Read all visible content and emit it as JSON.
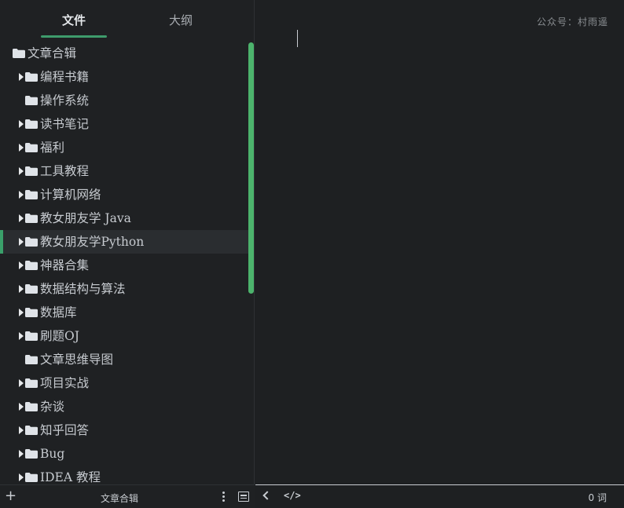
{
  "sidebar": {
    "tabs": [
      {
        "label": "文件",
        "active": true
      },
      {
        "label": "大纲",
        "active": false
      }
    ],
    "tree": [
      {
        "label": "文章合辑",
        "level": 0,
        "expandable": false,
        "selected": false
      },
      {
        "label": "编程书籍",
        "level": 1,
        "expandable": true,
        "selected": false
      },
      {
        "label": "操作系统",
        "level": 1,
        "expandable": false,
        "selected": false
      },
      {
        "label": "读书笔记",
        "level": 1,
        "expandable": true,
        "selected": false
      },
      {
        "label": "福利",
        "level": 1,
        "expandable": true,
        "selected": false
      },
      {
        "label": "工具教程",
        "level": 1,
        "expandable": true,
        "selected": false
      },
      {
        "label": "计算机网络",
        "level": 1,
        "expandable": true,
        "selected": false
      },
      {
        "label": "教女朋友学 Java",
        "level": 1,
        "expandable": true,
        "selected": false
      },
      {
        "label": "教女朋友学Python",
        "level": 1,
        "expandable": true,
        "selected": true
      },
      {
        "label": "神器合集",
        "level": 1,
        "expandable": true,
        "selected": false
      },
      {
        "label": "数据结构与算法",
        "level": 1,
        "expandable": true,
        "selected": false
      },
      {
        "label": "数据库",
        "level": 1,
        "expandable": true,
        "selected": false
      },
      {
        "label": "刷题OJ",
        "level": 1,
        "expandable": true,
        "selected": false
      },
      {
        "label": "文章思维导图",
        "level": 1,
        "expandable": false,
        "selected": false
      },
      {
        "label": "项目实战",
        "level": 1,
        "expandable": true,
        "selected": false
      },
      {
        "label": "杂谈",
        "level": 1,
        "expandable": true,
        "selected": false
      },
      {
        "label": "知乎回答",
        "level": 1,
        "expandable": true,
        "selected": false
      },
      {
        "label": "Bug",
        "level": 1,
        "expandable": true,
        "selected": false
      },
      {
        "label": "IDEA 教程",
        "level": 1,
        "expandable": true,
        "selected": false
      }
    ],
    "bottom": {
      "add_icon": "plus-icon",
      "title": "文章合辑",
      "more_icon": "more-vertical-icon",
      "panel_icon": "panel-icon"
    }
  },
  "editor": {
    "watermark": "公众号：村雨遥"
  },
  "status_bar": {
    "back_icon": "chevron-left-icon",
    "source_icon": "code-icon",
    "source_label": "</>",
    "word_count": "0 词"
  },
  "colors": {
    "accent": "#3e9c6c",
    "scrollbar": "#4cb36c",
    "background": "#1e2022",
    "text": "#c9cdd2"
  }
}
